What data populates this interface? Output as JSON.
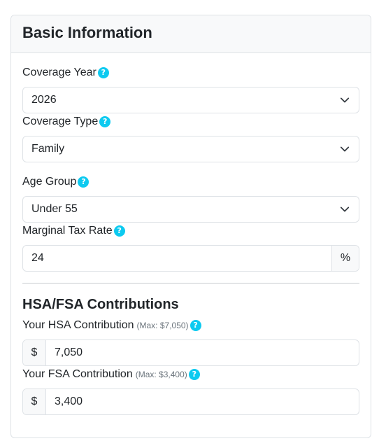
{
  "header": {
    "title": "Basic Information"
  },
  "fields": {
    "coverage_year": {
      "label": "Coverage Year",
      "value": "2026",
      "help_icon": "question-circle-icon"
    },
    "coverage_type": {
      "label": "Coverage Type",
      "value": "Family",
      "help_icon": "question-circle-icon"
    },
    "age_group": {
      "label": "Age Group",
      "value": "Under 55",
      "help_icon": "question-circle-icon"
    },
    "marginal_tax_rate": {
      "label": "Marginal Tax Rate",
      "value": "24",
      "suffix": "%",
      "help_icon": "question-circle-icon"
    }
  },
  "contributions": {
    "title": "HSA/FSA Contributions",
    "hsa": {
      "label": "Your HSA Contribution",
      "hint": "(Max: $7,050)",
      "prefix": "$",
      "value": "7,050"
    },
    "fsa": {
      "label": "Your FSA Contribution",
      "hint": "(Max: $3,400)",
      "prefix": "$",
      "value": "3,400"
    }
  },
  "help_glyph": "?",
  "colors": {
    "help_icon": "#0dcaf0",
    "header_bg": "#f8f9fa",
    "border": "#dee2e6",
    "text": "#212529"
  }
}
